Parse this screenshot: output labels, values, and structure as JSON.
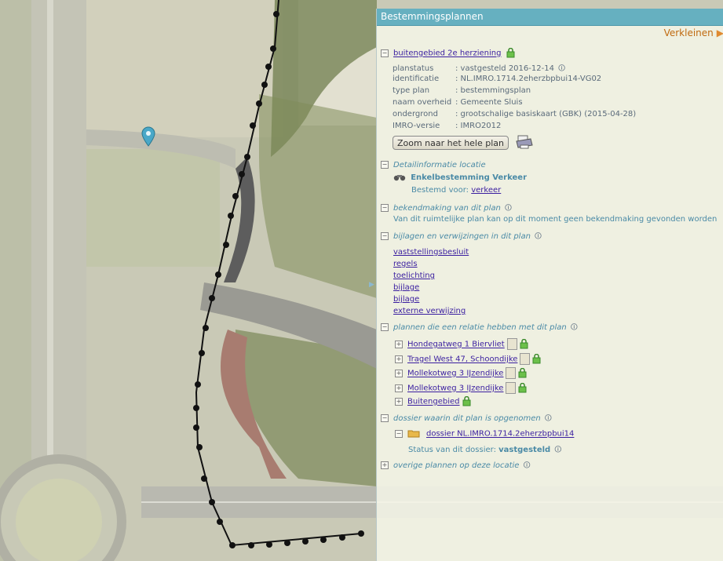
{
  "panel": {
    "title": "Bestemmingsplannen",
    "collapse_label": "Verkleinen",
    "collapse_arrow": "▶",
    "plan": {
      "name": "buitengebied 2e herziening",
      "fields": [
        {
          "key": "planstatus",
          "value": ": vastgesteld 2016-12-14"
        },
        {
          "key": "identificatie",
          "value": ": NL.IMRO.1714.2eherzbpbui14-VG02"
        },
        {
          "key": "type plan",
          "value": ": bestemmingsplan"
        },
        {
          "key": "naam overheid",
          "value": ": Gemeente Sluis"
        },
        {
          "key": "ondergrond",
          "value": ": grootschalige basiskaart (GBK) (2015-04-28)"
        },
        {
          "key": "IMRO-versie",
          "value": ": IMRO2012"
        }
      ],
      "zoom_button": "Zoom naar het hele plan"
    },
    "detail": {
      "heading": "Detailinformatie locatie",
      "bestemming": "Enkelbestemming Verkeer",
      "bestemd_label": "Bestemd voor:",
      "bestemd_value": "verkeer"
    },
    "bekendmaking": {
      "heading": "bekendmaking van dit plan",
      "text": "Van dit ruimtelijke plan kan op dit moment geen bekendmaking gevonden worden"
    },
    "bijlagen": {
      "heading": "bijlagen en verwijzingen in dit plan",
      "links": [
        "vaststellingsbesluit",
        "regels",
        "toelichting",
        "bijlage",
        "bijlage",
        "externe verwijzing"
      ]
    },
    "relaties": {
      "heading": "plannen die een relatie hebben met dit plan",
      "items": [
        {
          "label": "Hondegatweg 1 Biervliet"
        },
        {
          "label": "Tragel West 47, Schoondijke"
        },
        {
          "label": "Mollekotweg 3 IJzendijke"
        },
        {
          "label": "Mollekotweg 3 IJzendijke"
        },
        {
          "label": "Buitengebied"
        }
      ]
    },
    "dossier": {
      "heading": "dossier waarin dit plan is opgenomen",
      "name": "dossier NL.IMRO.1714.2eherzbpbui14",
      "status_label": "Status van dit dossier:",
      "status_value": "vastgesteld"
    },
    "overige": {
      "heading": "overige plannen op deze locatie"
    },
    "icons": {
      "expand": "⊞",
      "collapse": "⊟",
      "info": "🛈"
    }
  }
}
